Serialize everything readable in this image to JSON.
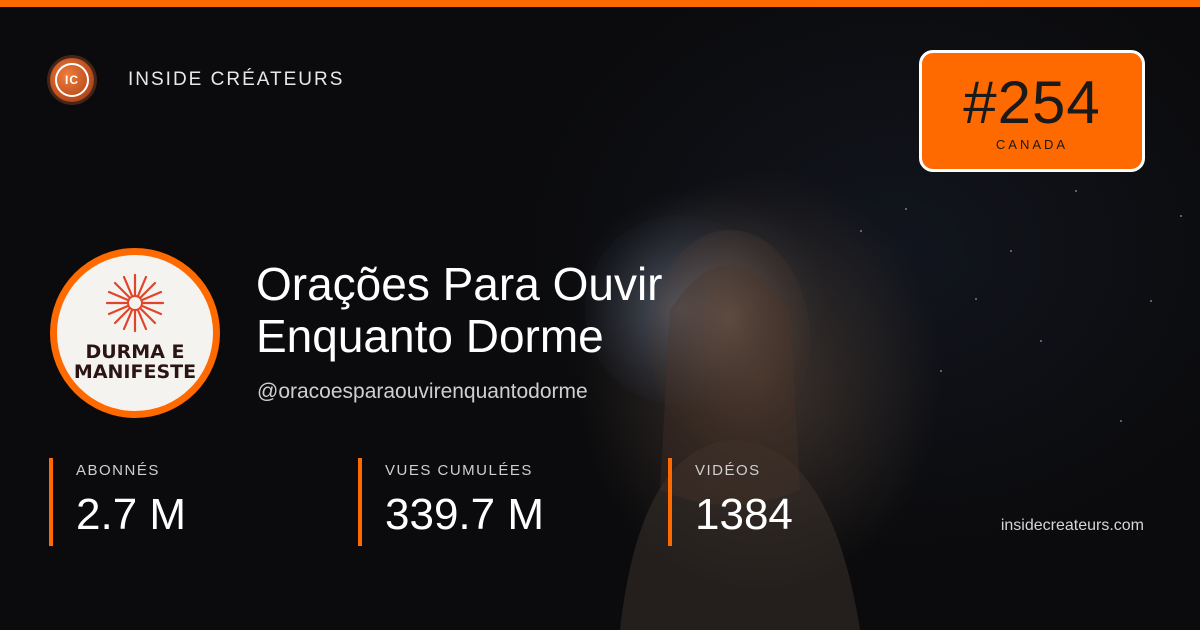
{
  "brand": {
    "name": "INSIDE CRÉATEURS",
    "logo_text": "IC"
  },
  "rank": {
    "number": "#254",
    "country": "CANADA"
  },
  "avatar": {
    "line1": "DURMA E",
    "line2": "MANIFESTE",
    "icon": "sun-burst-icon"
  },
  "channel": {
    "title_line1": "Orações Para Ouvir",
    "title_line2": "Enquanto Dorme",
    "handle": "@oracoesparaouvirenquantodorme"
  },
  "stats": [
    {
      "label": "ABONNÉS",
      "value": "2.7 M"
    },
    {
      "label": "VUES CUMULÉES",
      "value": "339.7 M"
    },
    {
      "label": "VIDÉOS",
      "value": "1384"
    }
  ],
  "site": "insidecreateurs.com",
  "colors": {
    "accent": "#ff6a00",
    "background": "#0b0b0d",
    "text": "#ffffff"
  }
}
